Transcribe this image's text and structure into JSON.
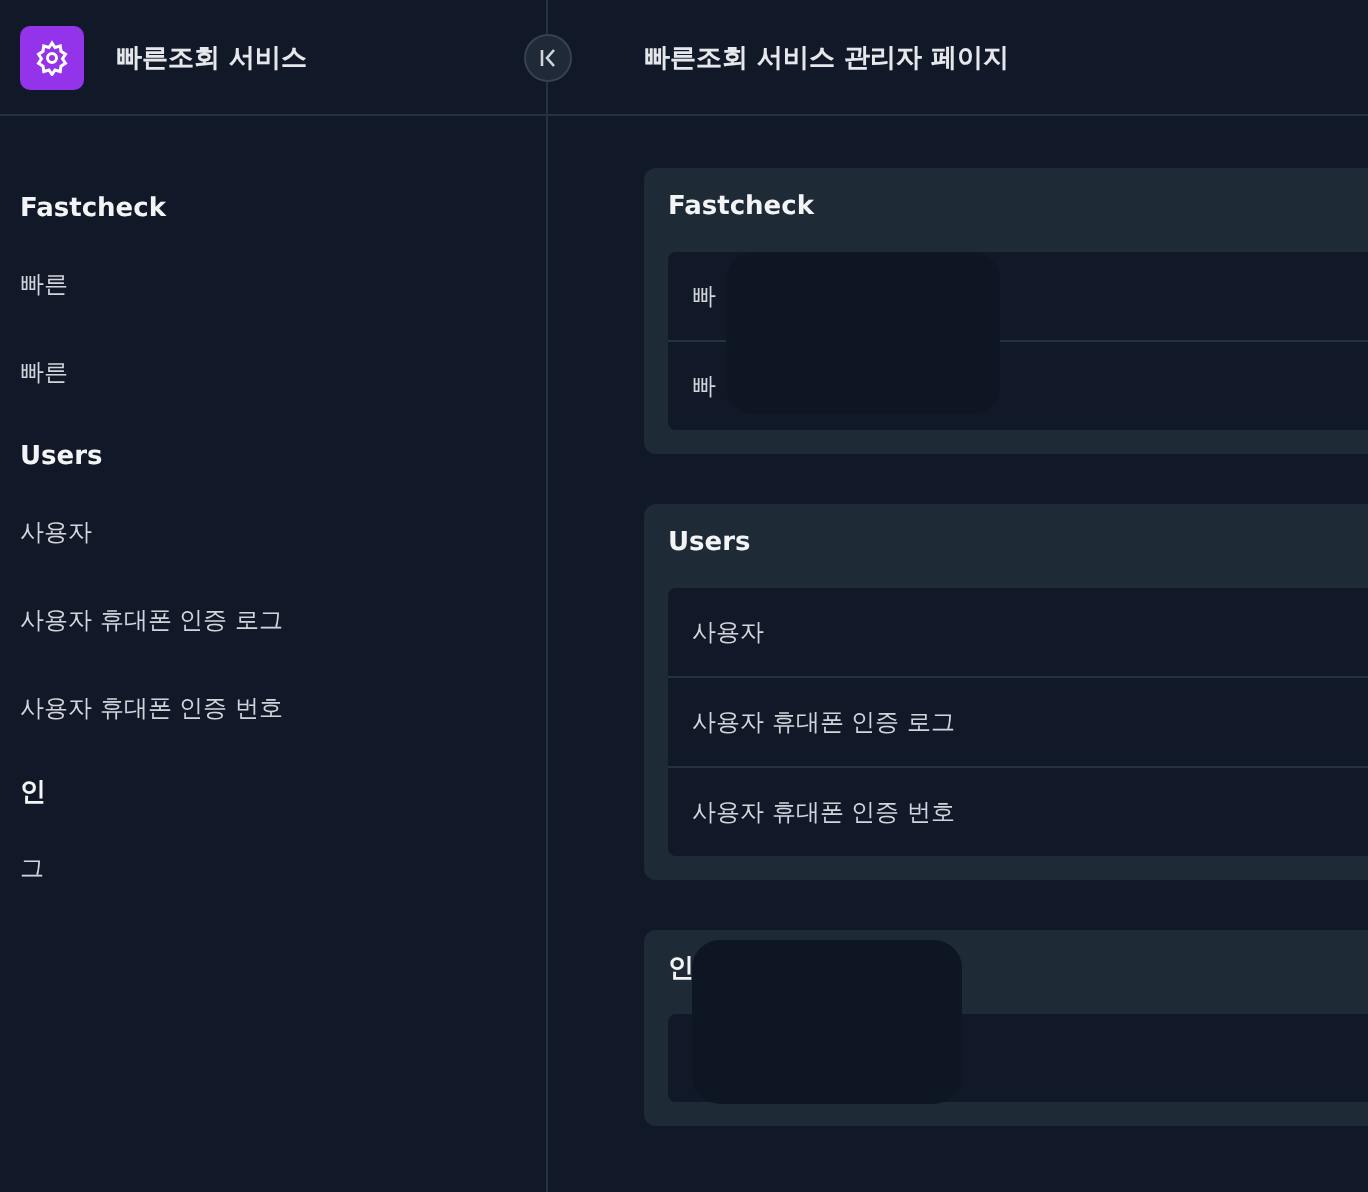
{
  "brand": {
    "title": "빠른조회 서비스"
  },
  "page_title": "빠른조회 서비스 관리자 페이지",
  "sidebar": {
    "groups": [
      {
        "heading": "Fastcheck",
        "items": [
          "빠른",
          "빠른"
        ]
      },
      {
        "heading": "Users",
        "items": [
          "사용자",
          "사용자 휴대폰 인증 로그",
          "사용자 휴대폰 인증 번호"
        ]
      },
      {
        "heading": "인",
        "items": [
          "그"
        ]
      }
    ]
  },
  "cards": [
    {
      "title": "Fastcheck",
      "rows": [
        "빠",
        "빠"
      ],
      "redacted": true
    },
    {
      "title": "Users",
      "rows": [
        "사용자",
        "사용자 휴대폰 인증 로그",
        "사용자 휴대폰 인증 번호"
      ],
      "redacted": false
    },
    {
      "title": "인",
      "rows": [
        ""
      ],
      "redacted": true
    }
  ]
}
